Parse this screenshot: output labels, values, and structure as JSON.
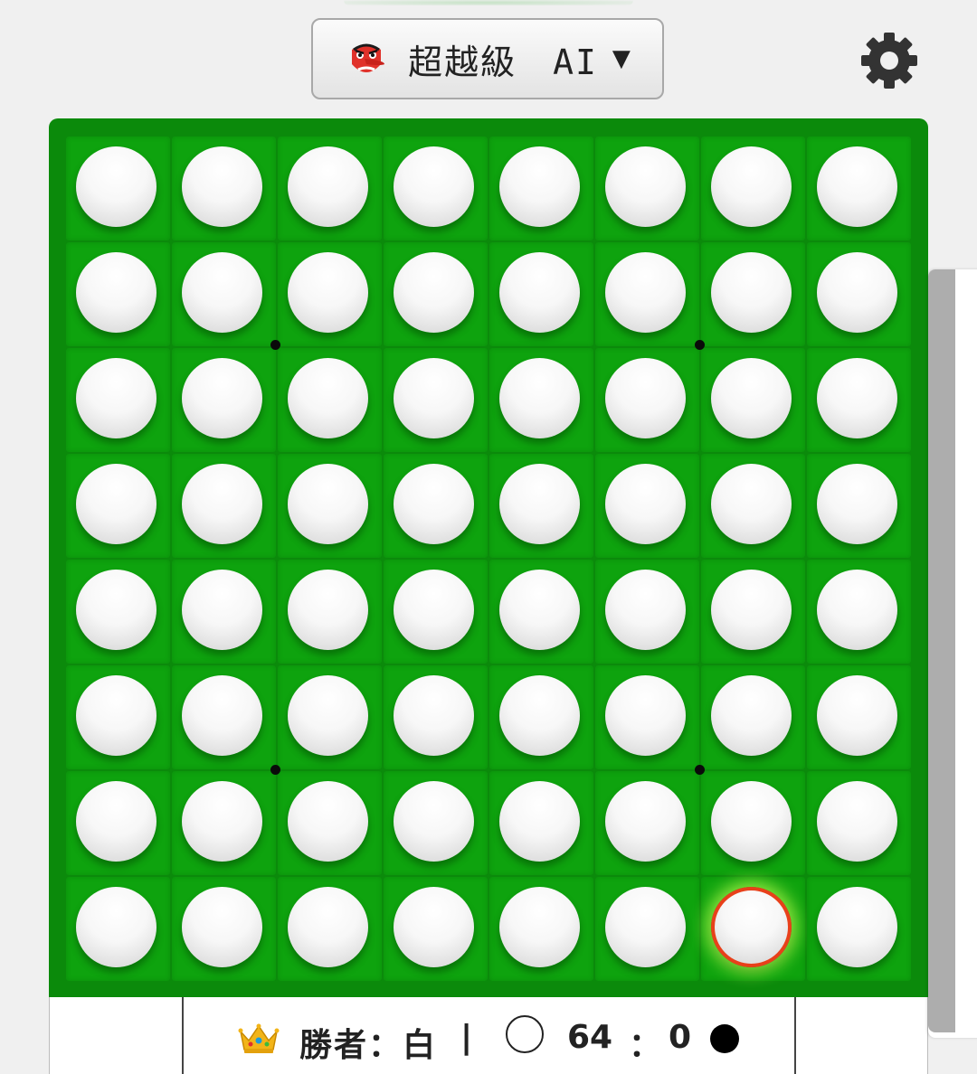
{
  "header": {
    "level_label": "超越級　AI",
    "level_icon": "tengu-mask-icon",
    "caret": "▼",
    "settings_icon": "gear-icon"
  },
  "board": {
    "size": 8,
    "colors": {
      "board": "#0b8a0b",
      "cell": "#0ea30e",
      "last_move_ring": "#e8401a"
    },
    "last_move": {
      "row": 7,
      "col": 6
    },
    "rows": [
      [
        "white",
        "white",
        "white",
        "white",
        "white",
        "white",
        "white",
        "white"
      ],
      [
        "white",
        "white",
        "white",
        "white",
        "white",
        "white",
        "white",
        "white"
      ],
      [
        "white",
        "white",
        "white",
        "white",
        "white",
        "white",
        "white",
        "white"
      ],
      [
        "white",
        "white",
        "white",
        "white",
        "white",
        "white",
        "white",
        "white"
      ],
      [
        "white",
        "white",
        "white",
        "white",
        "white",
        "white",
        "white",
        "white"
      ],
      [
        "white",
        "white",
        "white",
        "white",
        "white",
        "white",
        "white",
        "white"
      ],
      [
        "white",
        "white",
        "white",
        "white",
        "white",
        "white",
        "white",
        "white"
      ],
      [
        "white",
        "white",
        "white",
        "white",
        "white",
        "white",
        "white",
        "white"
      ]
    ]
  },
  "status": {
    "crown_icon": "crown-icon",
    "winner_text": "勝者：白",
    "separator": "|",
    "white_score": "64",
    "colon": "：",
    "black_score": "0"
  }
}
